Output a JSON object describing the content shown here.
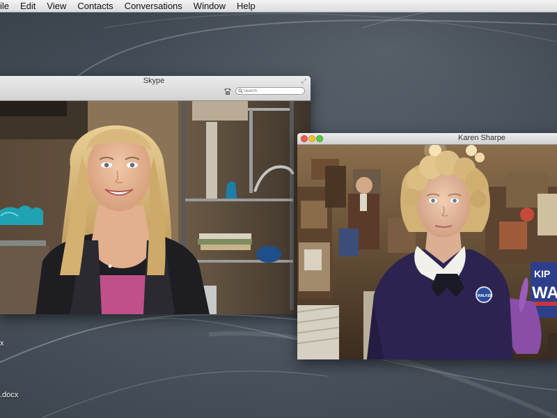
{
  "menubar": {
    "items": [
      "ile",
      "Edit",
      "View",
      "Contacts",
      "Conversations",
      "Window",
      "Help"
    ]
  },
  "desktop": {
    "files": [
      "x",
      ".docx"
    ]
  },
  "skype_window": {
    "title": "Skype",
    "search_placeholder": "Search"
  },
  "call_window": {
    "title": "Karen Sharpe",
    "campaign_sign": [
      "KIP",
      "WA"
    ],
    "badge": "WALKER"
  },
  "colors": {
    "close": "#ee5a50",
    "minimize": "#f5bd2f",
    "zoom": "#5fc73d",
    "menubar": "#e6e6e6"
  }
}
